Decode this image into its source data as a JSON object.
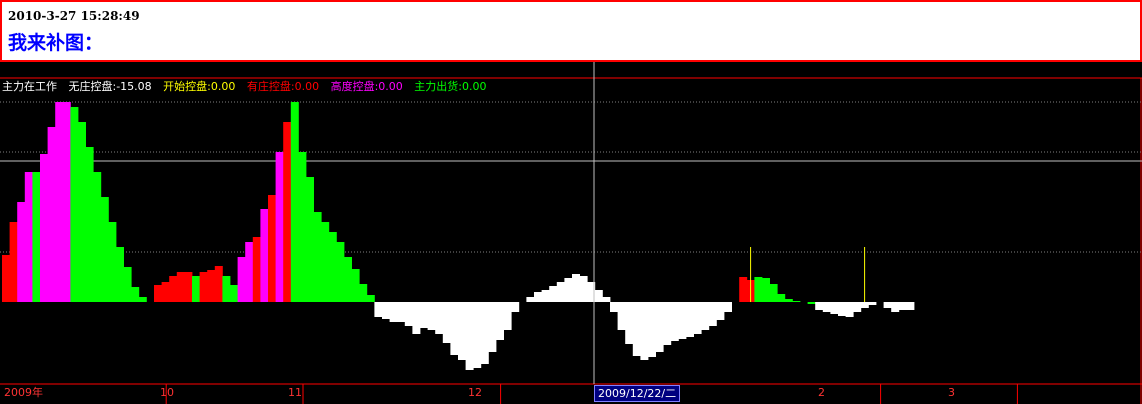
{
  "header": {
    "datetime": "2010-3-27 15:28:49",
    "title": "我来补图："
  },
  "legend": {
    "indicator_name": "主力在工作",
    "items": [
      {
        "label": "无庄控盘:-15.08",
        "color": "#ffffff"
      },
      {
        "label": "开始控盘:0.00",
        "color": "#ffff00"
      },
      {
        "label": "有庄控盘:0.00",
        "color": "#ff0000"
      },
      {
        "label": "高度控盘:0.00",
        "color": "#ff00ff"
      },
      {
        "label": "主力出货:0.00",
        "color": "#00ff00"
      }
    ]
  },
  "x_axis": {
    "labels": [
      "2009年",
      "10",
      "11",
      "12",
      "2",
      "3"
    ],
    "cursor_label": "2009/12/22/二"
  },
  "colors": {
    "background": "#000000",
    "grid": "#808080",
    "axis": "#ff0000",
    "no_control": "#ffffff",
    "start_control": "#ffff00",
    "has_control": "#ff0000",
    "high_control": "#ff00ff",
    "distribution": "#00ff00"
  },
  "chart_data": {
    "type": "bar",
    "title": "主力在工作",
    "xlabel": "",
    "ylabel": "",
    "cursor_date": "2009/12/22/二",
    "note_values_estimated": true,
    "series": [
      {
        "name": "无庄控盘",
        "color": "#ffffff"
      },
      {
        "name": "有庄控盘",
        "color": "#ff0000"
      },
      {
        "name": "高度控盘",
        "color": "#ff00ff"
      },
      {
        "name": "主力出货",
        "color": "#00ff00"
      },
      {
        "name": "开始控盘",
        "color": "#ffff00"
      }
    ],
    "values": [
      47,
      80,
      100,
      130,
      130,
      148,
      175,
      200,
      200,
      195,
      180,
      155,
      130,
      105,
      80,
      55,
      35,
      15,
      5,
      0,
      17,
      20,
      26,
      30,
      30,
      26,
      30,
      32,
      36,
      26,
      17,
      45,
      60,
      65,
      93,
      107,
      150,
      180,
      200,
      150,
      125,
      90,
      80,
      70,
      60,
      45,
      33,
      18,
      7,
      -15,
      -17,
      -20,
      -20,
      -24,
      -32,
      -26,
      -28,
      -32,
      -41,
      -53,
      -58,
      -68,
      -66,
      -62,
      -50,
      -38,
      -28,
      -10,
      0,
      5,
      10,
      12,
      16,
      20,
      24,
      28,
      26,
      20,
      12,
      5,
      -10,
      -28,
      -42,
      -54,
      -58,
      -55,
      -50,
      -43,
      -39,
      -37,
      -35,
      -32,
      -28,
      -24,
      -18,
      -10,
      0,
      25,
      22,
      25,
      24,
      18,
      8,
      3,
      1,
      0,
      -2,
      -8,
      -10,
      -12,
      -14,
      -15,
      -10,
      -6,
      -3,
      0,
      -6,
      -10,
      -8,
      -8
    ],
    "colors": [
      "R",
      "R",
      "M",
      "M",
      "G",
      "M",
      "M",
      "M",
      "M",
      "G",
      "G",
      "G",
      "G",
      "G",
      "G",
      "G",
      "G",
      "G",
      "G",
      "G",
      "R",
      "R",
      "R",
      "R",
      "R",
      "G",
      "R",
      "R",
      "R",
      "G",
      "G",
      "M",
      "M",
      "R",
      "M",
      "R",
      "M",
      "R",
      "G",
      "G",
      "G",
      "G",
      "G",
      "G",
      "G",
      "G",
      "G",
      "G",
      "G",
      "W",
      "W",
      "W",
      "W",
      "W",
      "W",
      "W",
      "W",
      "W",
      "W",
      "W",
      "W",
      "W",
      "W",
      "W",
      "W",
      "W",
      "W",
      "W",
      "W",
      "W",
      "W",
      "W",
      "W",
      "W",
      "W",
      "W",
      "W",
      "W",
      "W",
      "W",
      "W",
      "W",
      "W",
      "W",
      "W",
      "W",
      "W",
      "W",
      "W",
      "W",
      "W",
      "W",
      "W",
      "W",
      "W",
      "W",
      "W",
      "R",
      "R",
      "G",
      "G",
      "G",
      "G",
      "G",
      "G",
      "R",
      "G",
      "W",
      "W",
      "W",
      "W",
      "W",
      "W",
      "W",
      "W",
      "W",
      "W",
      "W",
      "W",
      "W"
    ],
    "spikes": [
      {
        "index": 98,
        "value": 55,
        "color": "#ffff00"
      },
      {
        "index": 113,
        "value": 55,
        "color": "#ffff00"
      }
    ],
    "x_ticks": [
      {
        "label": "2009年",
        "index": 0
      },
      {
        "label": "10",
        "index": 22
      },
      {
        "label": "11",
        "index": 40
      },
      {
        "label": "12",
        "index": 66
      },
      {
        "label": "2",
        "index": 116
      },
      {
        "label": "3",
        "index": 134
      }
    ]
  }
}
